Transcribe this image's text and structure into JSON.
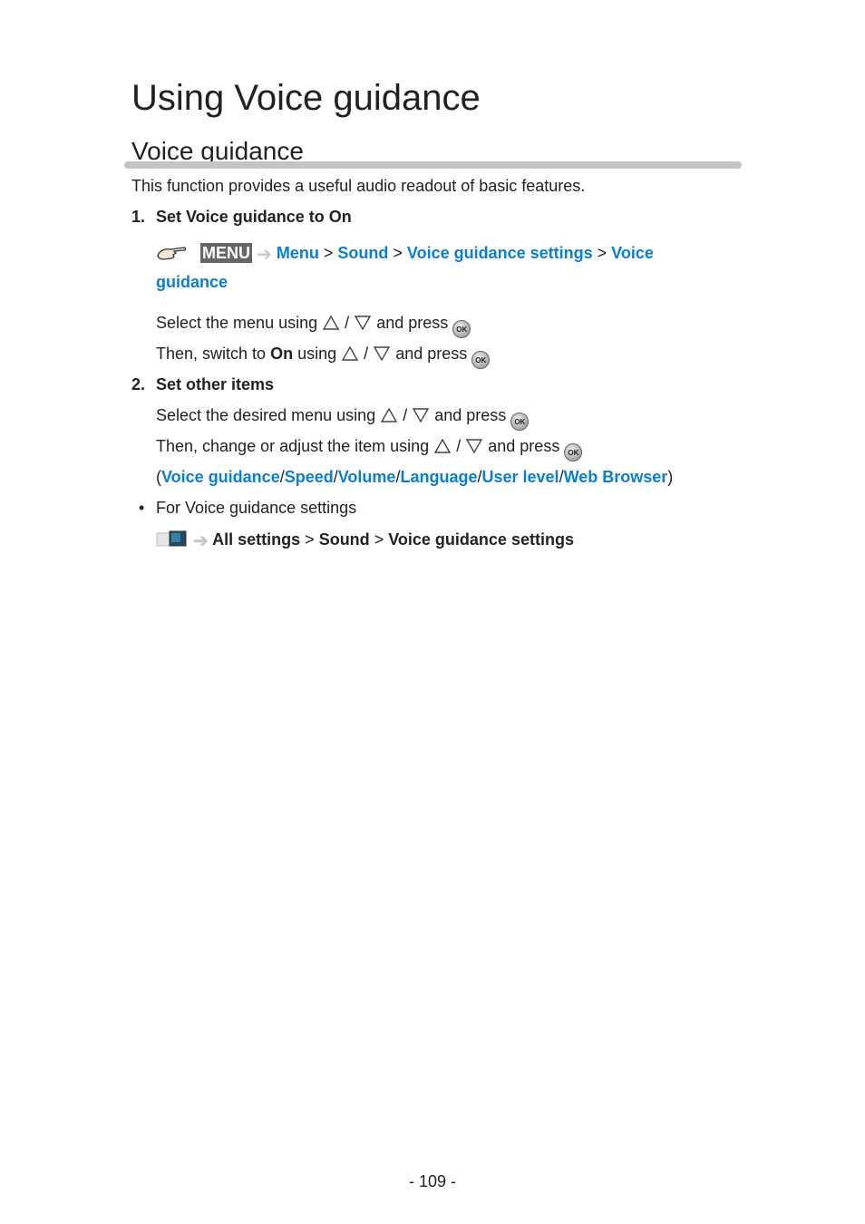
{
  "page": {
    "title": "Using Voice guidance",
    "section_title": "Voice guidance",
    "intro": "This function provides a useful audio readout of basic features.",
    "page_number": "- 109 -"
  },
  "step1": {
    "number": "1.",
    "heading": "Set Voice guidance to On",
    "menu_badge": "MENU",
    "path": [
      "Menu",
      "Sound",
      "Voice guidance settings",
      "Voice",
      "guidance"
    ],
    "separator": ">",
    "line1_prefix": "Select the menu using",
    "slash": "/",
    "and_press": "and press",
    "line2_prefix": "Then, switch to",
    "line2_bold": "On",
    "line2_mid": "using"
  },
  "step2": {
    "number": "2.",
    "heading": "Set other items",
    "line1_prefix": "Select the desired menu using",
    "line2_prefix": "Then, change or adjust the item using",
    "open_paren": "(",
    "close_paren": ")",
    "items": [
      "Voice guidance",
      "Speed",
      "Volume",
      "Language",
      "User level",
      "Web Browser"
    ]
  },
  "note": {
    "bullet": "•",
    "text": "For Voice guidance settings",
    "path": [
      "All settings",
      "Sound",
      "Voice guidance settings"
    ]
  },
  "icons": {
    "ok_label": "OK"
  },
  "colors": {
    "link": "#0a7fcf",
    "rule": "#c4c4c4"
  }
}
